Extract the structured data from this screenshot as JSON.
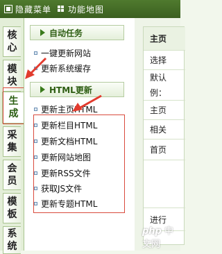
{
  "topbar": {
    "hide_menu": "隐藏菜单",
    "site_map": "功能地图"
  },
  "tabs": [
    {
      "c1": "核",
      "c2": "心"
    },
    {
      "c1": "模",
      "c2": "块"
    },
    {
      "c1": "生",
      "c2": "成"
    },
    {
      "c1": "采",
      "c2": "集"
    },
    {
      "c1": "会",
      "c2": "员"
    },
    {
      "c1": "模",
      "c2": "板"
    },
    {
      "c1": "系",
      "c2": "统"
    }
  ],
  "section_auto": {
    "title": "自动任务",
    "items": [
      "一键更新网站",
      "更新系统缓存"
    ]
  },
  "section_html": {
    "title": "HTML更新",
    "items": [
      "更新主页HTML",
      "更新栏目HTML",
      "更新文档HTML",
      "更新网站地图",
      "更新RSS文件",
      "获取JS文件",
      "更新专题HTML"
    ]
  },
  "right": {
    "header": "主页",
    "rows": [
      "选择",
      "默认",
      "例：",
      "主页",
      "相关",
      "首页",
      "进行"
    ]
  },
  "watermark": {
    "p": "php",
    "rest": " 中文网"
  },
  "colors": {
    "topbar": "#3b5f20",
    "accent": "#2d5d12",
    "highlight": "#d94a3c"
  }
}
